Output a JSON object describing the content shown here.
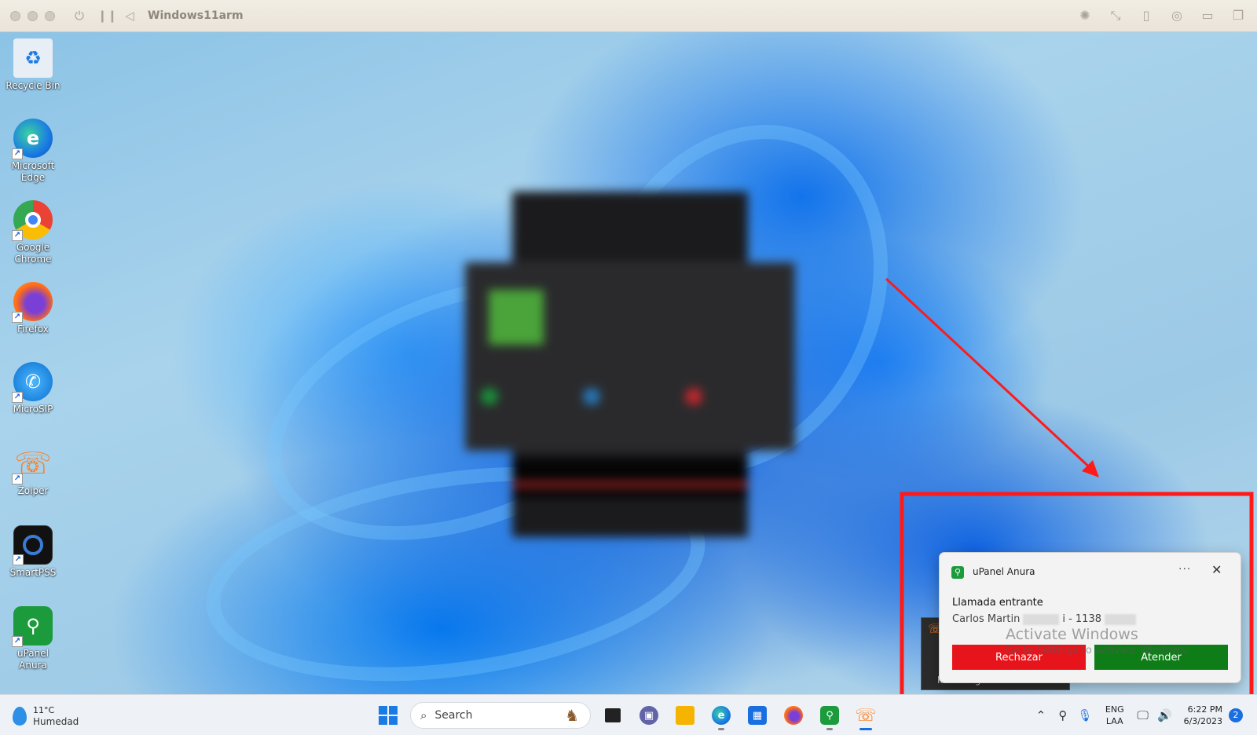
{
  "vm_window": {
    "title": "Windows11arm"
  },
  "desktop_icons": [
    {
      "label": "Recycle Bin",
      "icon": "recycle-bin-icon"
    },
    {
      "label": "Microsoft Edge",
      "icon": "edge-icon"
    },
    {
      "label": "Google Chrome",
      "icon": "chrome-icon"
    },
    {
      "label": "Firefox",
      "icon": "firefox-icon"
    },
    {
      "label": "MicroSIP",
      "icon": "microsip-icon"
    },
    {
      "label": "Zoiper",
      "icon": "zoiper-icon"
    },
    {
      "label": "SmartPSS",
      "icon": "smartpss-icon"
    },
    {
      "label": "uPanel Anura",
      "icon": "upanel-anura-icon"
    }
  ],
  "notification": {
    "app_name": "uPanel Anura",
    "title": "Llamada entrante",
    "caller_prefix": "Carlos Martin",
    "caller_mid": "i - 1138",
    "reject_label": "Rechazar",
    "accept_label": "Atender",
    "more_label": "···",
    "close_label": "✕"
  },
  "background_toast": {
    "label": "Incoming call"
  },
  "activation_watermark": {
    "line1": "Activate Windows",
    "line2": "Go to Settings to activate Windows."
  },
  "taskbar": {
    "weather": {
      "temp": "11°C",
      "condition": "Humedad"
    },
    "search_placeholder": "Search",
    "tray": {
      "lang_line1": "ENG",
      "lang_line2": "LAA",
      "time": "6:22 PM",
      "date": "6/3/2023",
      "notification_count": "2"
    }
  },
  "colors": {
    "annotation_red": "#ff1a1a",
    "reject_button": "#e8141b",
    "accept_button": "#0f7d17",
    "accent_blue": "#1a6fe0"
  }
}
